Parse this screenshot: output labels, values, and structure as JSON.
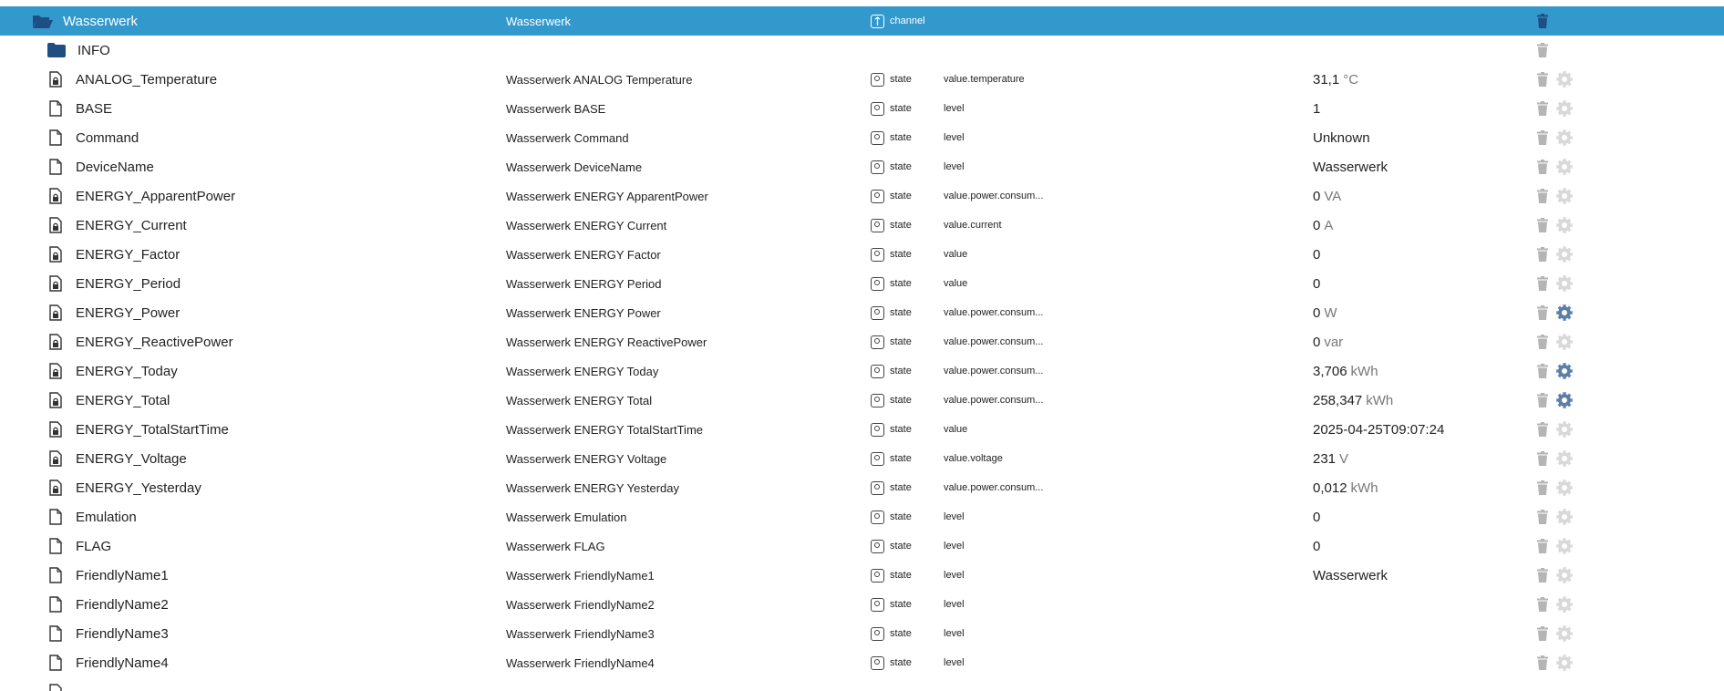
{
  "channel": {
    "name": "Wasserwerk",
    "title": "Wasserwerk",
    "type": "channel"
  },
  "folder": {
    "name": "INFO"
  },
  "rows": [
    {
      "name": "ANALOG_Temperature",
      "title": "Wasserwerk ANALOG Temperature",
      "type": "state",
      "role": "value.temperature",
      "value": "31,1",
      "unit": "°C",
      "locked": true,
      "gear_active": false
    },
    {
      "name": "BASE",
      "title": "Wasserwerk BASE",
      "type": "state",
      "role": "level",
      "value": "1",
      "unit": "",
      "locked": false,
      "gear_active": false
    },
    {
      "name": "Command",
      "title": "Wasserwerk Command",
      "type": "state",
      "role": "level",
      "value": "Unknown",
      "unit": "",
      "locked": false,
      "gear_active": false
    },
    {
      "name": "DeviceName",
      "title": "Wasserwerk DeviceName",
      "type": "state",
      "role": "level",
      "value": "Wasserwerk",
      "unit": "",
      "locked": false,
      "gear_active": false
    },
    {
      "name": "ENERGY_ApparentPower",
      "title": "Wasserwerk ENERGY ApparentPower",
      "type": "state",
      "role": "value.power.consum...",
      "value": "0",
      "unit": "VA",
      "locked": true,
      "gear_active": false
    },
    {
      "name": "ENERGY_Current",
      "title": "Wasserwerk ENERGY Current",
      "type": "state",
      "role": "value.current",
      "value": "0",
      "unit": "A",
      "locked": true,
      "gear_active": false
    },
    {
      "name": "ENERGY_Factor",
      "title": "Wasserwerk ENERGY Factor",
      "type": "state",
      "role": "value",
      "value": "0",
      "unit": "",
      "locked": true,
      "gear_active": false
    },
    {
      "name": "ENERGY_Period",
      "title": "Wasserwerk ENERGY Period",
      "type": "state",
      "role": "value",
      "value": "0",
      "unit": "",
      "locked": true,
      "gear_active": false
    },
    {
      "name": "ENERGY_Power",
      "title": "Wasserwerk ENERGY Power",
      "type": "state",
      "role": "value.power.consum...",
      "value": "0",
      "unit": "W",
      "locked": true,
      "gear_active": true
    },
    {
      "name": "ENERGY_ReactivePower",
      "title": "Wasserwerk ENERGY ReactivePower",
      "type": "state",
      "role": "value.power.consum...",
      "value": "0",
      "unit": "var",
      "locked": true,
      "gear_active": false
    },
    {
      "name": "ENERGY_Today",
      "title": "Wasserwerk ENERGY Today",
      "type": "state",
      "role": "value.power.consum...",
      "value": "3,706",
      "unit": "kWh",
      "locked": true,
      "gear_active": true
    },
    {
      "name": "ENERGY_Total",
      "title": "Wasserwerk ENERGY Total",
      "type": "state",
      "role": "value.power.consum...",
      "value": "258,347",
      "unit": "kWh",
      "locked": true,
      "gear_active": true
    },
    {
      "name": "ENERGY_TotalStartTime",
      "title": "Wasserwerk ENERGY TotalStartTime",
      "type": "state",
      "role": "value",
      "value": "2025-04-25T09:07:24",
      "unit": "",
      "locked": true,
      "gear_active": false
    },
    {
      "name": "ENERGY_Voltage",
      "title": "Wasserwerk ENERGY Voltage",
      "type": "state",
      "role": "value.voltage",
      "value": "231",
      "unit": "V",
      "locked": true,
      "gear_active": false
    },
    {
      "name": "ENERGY_Yesterday",
      "title": "Wasserwerk ENERGY Yesterday",
      "type": "state",
      "role": "value.power.consum...",
      "value": "0,012",
      "unit": "kWh",
      "locked": true,
      "gear_active": false
    },
    {
      "name": "Emulation",
      "title": "Wasserwerk Emulation",
      "type": "state",
      "role": "level",
      "value": "0",
      "unit": "",
      "locked": false,
      "gear_active": false
    },
    {
      "name": "FLAG",
      "title": "Wasserwerk FLAG",
      "type": "state",
      "role": "level",
      "value": "0",
      "unit": "",
      "locked": false,
      "gear_active": false
    },
    {
      "name": "FriendlyName1",
      "title": "Wasserwerk FriendlyName1",
      "type": "state",
      "role": "level",
      "value": "Wasserwerk",
      "unit": "",
      "locked": false,
      "gear_active": false
    },
    {
      "name": "FriendlyName2",
      "title": "Wasserwerk FriendlyName2",
      "type": "state",
      "role": "level",
      "value": "",
      "unit": "",
      "locked": false,
      "gear_active": false
    },
    {
      "name": "FriendlyName3",
      "title": "Wasserwerk FriendlyName3",
      "type": "state",
      "role": "level",
      "value": "",
      "unit": "",
      "locked": false,
      "gear_active": false
    },
    {
      "name": "FriendlyName4",
      "title": "Wasserwerk FriendlyName4",
      "type": "state",
      "role": "level",
      "value": "",
      "unit": "",
      "locked": false,
      "gear_active": false
    }
  ],
  "colors": {
    "selected_bg": "#3399cc",
    "gear_active": "#5b7fa6",
    "gear_dim": "#d9d9d9",
    "trash": "#b5b5b5"
  }
}
